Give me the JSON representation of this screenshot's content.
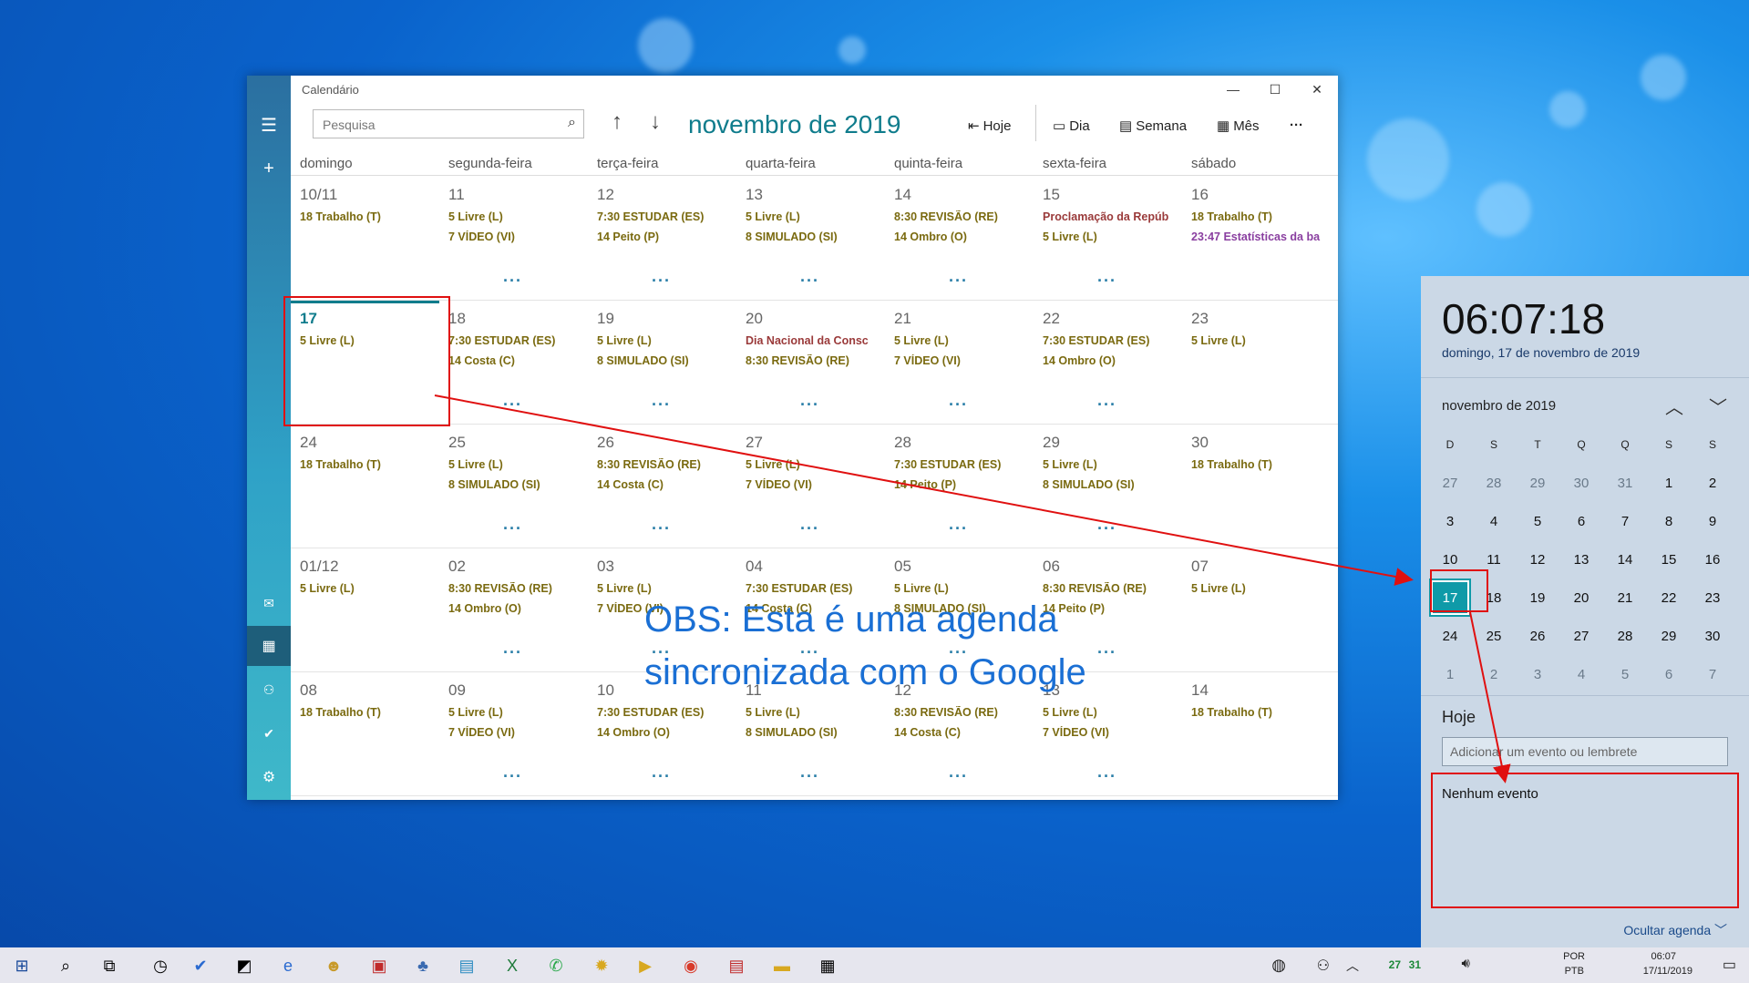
{
  "window": {
    "title": "Calendário",
    "minimize": "—",
    "maximize": "☐",
    "close": "✕"
  },
  "toolbar": {
    "search_placeholder": "Pesquisa",
    "month_title": "novembro de 2019",
    "today": "Hoje",
    "day": "Dia",
    "week": "Semana",
    "month": "Mês",
    "more": "···"
  },
  "day_headers": [
    "domingo",
    "segunda-feira",
    "terça-feira",
    "quarta-feira",
    "quinta-feira",
    "sexta-feira",
    "sábado"
  ],
  "weeks": [
    [
      {
        "d": "10/11",
        "ev": [
          "18 Trabalho (T)"
        ],
        "more": false
      },
      {
        "d": "11",
        "ev": [
          "5 Livre (L)",
          "7 VÍDEO (VI)"
        ],
        "more": true
      },
      {
        "d": "12",
        "ev": [
          "7:30 ESTUDAR (ES)",
          "14 Peito (P)"
        ],
        "more": true
      },
      {
        "d": "13",
        "ev": [
          "5 Livre (L)",
          "8 SIMULADO (SI)"
        ],
        "more": true
      },
      {
        "d": "14",
        "ev": [
          "8:30 REVISÃO (RE)",
          "14 Ombro (O)"
        ],
        "more": true
      },
      {
        "d": "15",
        "ev": [
          "Proclamação da Repúb",
          "5 Livre (L)"
        ],
        "more": true
      },
      {
        "d": "16",
        "ev": [
          "18 Trabalho (T)",
          "23:47 Estatísticas da ba"
        ],
        "more": false
      }
    ],
    [
      {
        "d": "17",
        "ev": [
          "5 Livre (L)"
        ],
        "more": false,
        "today": true
      },
      {
        "d": "18",
        "ev": [
          "7:30 ESTUDAR (ES)",
          "14 Costa (C)"
        ],
        "more": true
      },
      {
        "d": "19",
        "ev": [
          "5 Livre (L)",
          "8 SIMULADO (SI)"
        ],
        "more": true
      },
      {
        "d": "20",
        "ev": [
          "Dia Nacional da Consc",
          "8:30 REVISÃO (RE)"
        ],
        "more": true
      },
      {
        "d": "21",
        "ev": [
          "5 Livre (L)",
          "7 VÍDEO (VI)"
        ],
        "more": true
      },
      {
        "d": "22",
        "ev": [
          "7:30 ESTUDAR (ES)",
          "14 Ombro (O)"
        ],
        "more": true
      },
      {
        "d": "23",
        "ev": [
          "5 Livre (L)"
        ],
        "more": false
      }
    ],
    [
      {
        "d": "24",
        "ev": [
          "18 Trabalho (T)"
        ],
        "more": false
      },
      {
        "d": "25",
        "ev": [
          "5 Livre (L)",
          "8 SIMULADO (SI)"
        ],
        "more": true
      },
      {
        "d": "26",
        "ev": [
          "8:30 REVISÃO (RE)",
          "14 Costa (C)"
        ],
        "more": true
      },
      {
        "d": "27",
        "ev": [
          "5 Livre (L)",
          "7 VÍDEO (VI)"
        ],
        "more": true
      },
      {
        "d": "28",
        "ev": [
          "7:30 ESTUDAR (ES)",
          "14 Peito (P)"
        ],
        "more": true
      },
      {
        "d": "29",
        "ev": [
          "5 Livre (L)",
          "8 SIMULADO (SI)"
        ],
        "more": true
      },
      {
        "d": "30",
        "ev": [
          "18 Trabalho (T)"
        ],
        "more": false
      }
    ],
    [
      {
        "d": "01/12",
        "ev": [
          "5 Livre (L)"
        ],
        "more": false,
        "other": true
      },
      {
        "d": "02",
        "ev": [
          "8:30 REVISÃO (RE)",
          "14 Ombro (O)"
        ],
        "more": true,
        "other": true
      },
      {
        "d": "03",
        "ev": [
          "5 Livre (L)",
          "7 VÍDEO (VI)"
        ],
        "more": true,
        "other": true
      },
      {
        "d": "04",
        "ev": [
          "7:30 ESTUDAR (ES)",
          "14 Costa (C)"
        ],
        "more": true,
        "other": true
      },
      {
        "d": "05",
        "ev": [
          "5 Livre (L)",
          "8 SIMULADO (SI)"
        ],
        "more": true,
        "other": true
      },
      {
        "d": "06",
        "ev": [
          "8:30 REVISÃO (RE)",
          "14 Peito (P)"
        ],
        "more": true,
        "other": true
      },
      {
        "d": "07",
        "ev": [
          "5 Livre (L)"
        ],
        "more": false,
        "other": true
      }
    ],
    [
      {
        "d": "08",
        "ev": [
          "18 Trabalho (T)"
        ],
        "more": false,
        "other": true
      },
      {
        "d": "09",
        "ev": [
          "5 Livre (L)",
          "7 VÍDEO (VI)"
        ],
        "more": true,
        "other": true
      },
      {
        "d": "10",
        "ev": [
          "7:30 ESTUDAR (ES)",
          "14 Ombro (O)"
        ],
        "more": true,
        "other": true
      },
      {
        "d": "11",
        "ev": [
          "5 Livre (L)",
          "8 SIMULADO (SI)"
        ],
        "more": true,
        "other": true
      },
      {
        "d": "12",
        "ev": [
          "8:30 REVISÃO (RE)",
          "14 Costa (C)"
        ],
        "more": true,
        "other": true
      },
      {
        "d": "13",
        "ev": [
          "5 Livre (L)",
          "7 VÍDEO (VI)"
        ],
        "more": true,
        "other": true
      },
      {
        "d": "14",
        "ev": [
          "18 Trabalho (T)"
        ],
        "more": false,
        "other": true
      }
    ]
  ],
  "more_glyph": "···",
  "annotation": {
    "line1": "OBS: Esta é uma agenda",
    "line2": "sincronizada com o Google"
  },
  "flyout": {
    "time": "06:07:18",
    "date": "domingo, 17 de novembro de 2019",
    "month_caption": "novembro de 2019",
    "weekday_letters": [
      "D",
      "S",
      "T",
      "Q",
      "Q",
      "S",
      "S"
    ],
    "grid": [
      [
        "27",
        "28",
        "29",
        "30",
        "31",
        "1",
        "2"
      ],
      [
        "3",
        "4",
        "5",
        "6",
        "7",
        "8",
        "9"
      ],
      [
        "10",
        "11",
        "12",
        "13",
        "14",
        "15",
        "16"
      ],
      [
        "17",
        "18",
        "19",
        "20",
        "21",
        "22",
        "23"
      ],
      [
        "24",
        "25",
        "26",
        "27",
        "28",
        "29",
        "30"
      ],
      [
        "1",
        "2",
        "3",
        "4",
        "5",
        "6",
        "7"
      ]
    ],
    "today_label": "Hoje",
    "add_placeholder": "Adicionar um evento ou lembrete",
    "no_events": "Nenhum evento",
    "hide": "Ocultar agenda"
  },
  "tray": {
    "lang1": "POR",
    "lang2": "PTB",
    "time": "06:07",
    "date": "17/11/2019",
    "n1": "27",
    "n2": "31"
  }
}
